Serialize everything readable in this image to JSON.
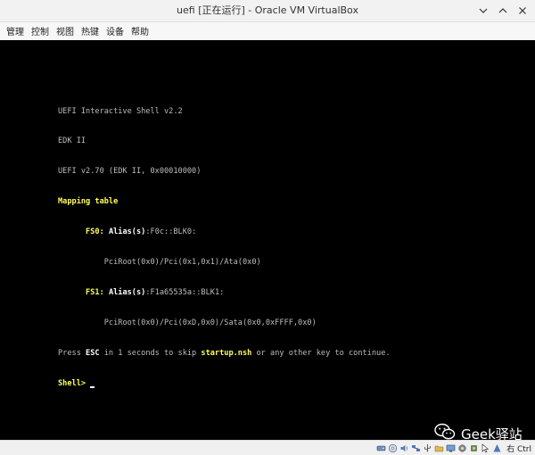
{
  "window": {
    "title": "uefi [正在运行] - Oracle VM VirtualBox"
  },
  "menubar": {
    "items": [
      "管理",
      "控制",
      "视图",
      "热键",
      "设备",
      "帮助"
    ]
  },
  "console": {
    "line1": "UEFI Interactive Shell v2.2",
    "line2": "EDK II",
    "line3": "UEFI v2.70 (EDK II, 0x00010000)",
    "line4": "Mapping table",
    "fs0_label": "FS0",
    "fs0_alias_key": "Alias(s)",
    "fs0_alias_val": ":F0c::BLK0:",
    "fs0_path": "PciRoot(0x0)/Pci(0x1,0x1)/Ata(0x0)",
    "fs1_label": "FS1",
    "fs1_alias_key": "Alias(s)",
    "fs1_alias_val": ":F1a65535a::BLK1:",
    "fs1_path": "PciRoot(0x0)/Pci(0xD,0x0)/Sata(0x0,0xFFFF,0x0)",
    "press_a": "Press ",
    "press_esc": "ESC",
    "press_b": " in 1 seconds to skip ",
    "press_startup": "startup.nsh",
    "press_c": " or any other key to continue.",
    "prompt": "Shell>"
  },
  "watermark": {
    "text": "Geek驿站"
  },
  "statusbar": {
    "host_key": "右 Ctrl"
  },
  "colors": {
    "console_bg": "#000000",
    "console_text": "#bdbdbd",
    "highlight_yellow": "#ffff55",
    "highlight_white": "#ffffff"
  }
}
